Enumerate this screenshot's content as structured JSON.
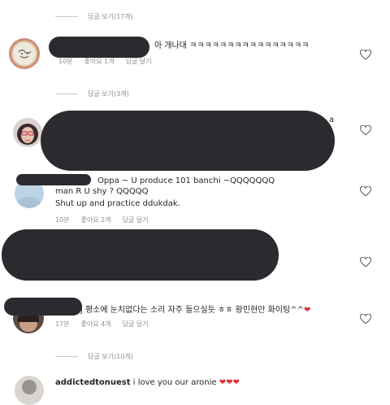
{
  "reply_toggles": [
    "답글 보기(17개)",
    "답글 보기(3개)",
    "답글 보기(10개)"
  ],
  "comments": [
    {
      "text": "아 개나대 ㅋㅋㅋㅋㅋㅋㅋㅋㅋㅋㅋㅋㅋㅋㅋㅋ",
      "time": "10분",
      "likes": "좋아요 1개",
      "reply": "답글 달기"
    },
    {
      "text_fragment": "a"
    },
    {
      "line1": "Oppa ~ U produce 101 banchi ~QQQQQQQ",
      "line2": "man R U shy ? QQQQQ",
      "line3": "Shut up and practice ddukdak.",
      "time": "10분",
      "likes": "좋아요 2개",
      "reply": "답글 달기"
    },
    {},
    {
      "text": "j 평소에 눈치없다는 소리 자주 들으실듯 ㅎㅎ 황민현만 화이팅^^",
      "time": "17분",
      "likes": "좋아요 4개",
      "reply": "답글 달기"
    },
    {
      "username": "addictedtonuest",
      "text": "i love you our aronie"
    }
  ],
  "heart_glyph": "❤",
  "colors": {
    "muted": "#8e8e8e",
    "red_heart": "#e0303b",
    "redaction": "#2b2b2f"
  }
}
